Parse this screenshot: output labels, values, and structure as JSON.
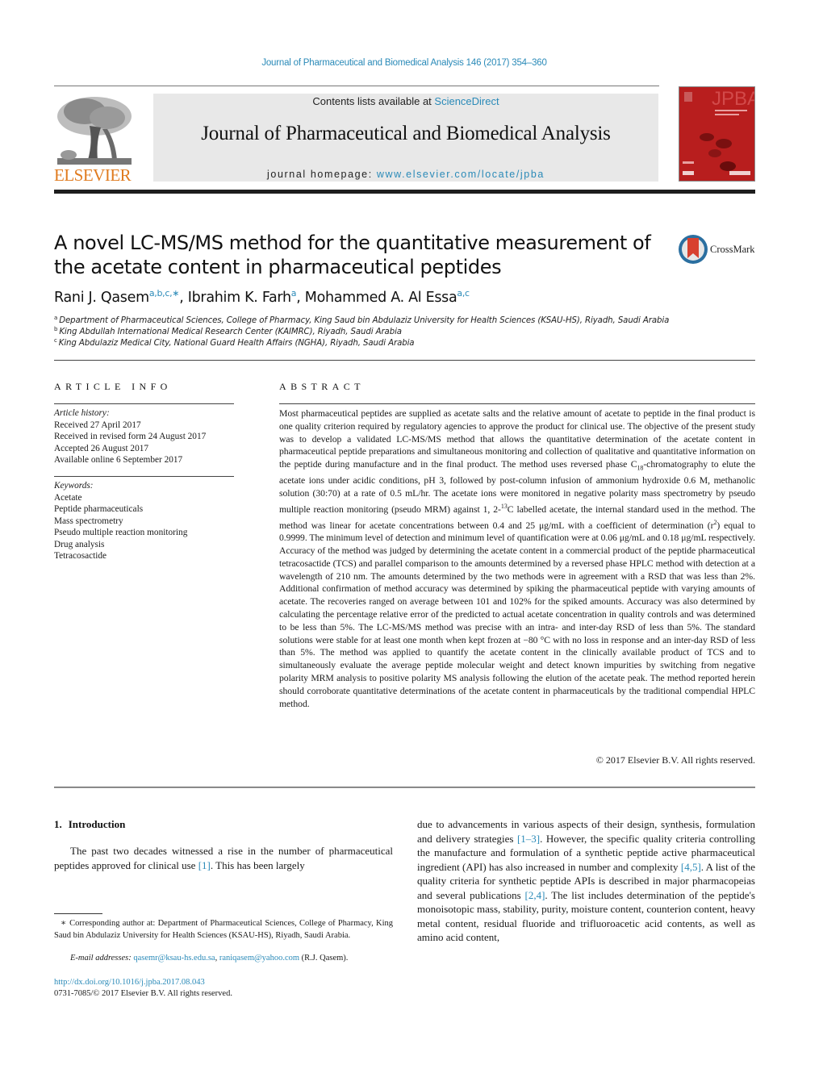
{
  "header": {
    "citation": "Journal of Pharmaceutical and Biomedical Analysis 146 (2017) 354–360",
    "contents_prefix": "Contents lists available at ",
    "contents_link": "ScienceDirect",
    "journal_title": "Journal of Pharmaceutical and Biomedical Analysis",
    "homepage_prefix": "journal homepage: ",
    "homepage_link": "www.elsevier.com/locate/jpba",
    "publisher_logo_text": "ELSEVIER",
    "cover_text": "JPBA",
    "colors": {
      "link": "#2a8ab8",
      "elsevier_orange": "#e07b1f",
      "cover_red": "#b81e1e",
      "banner_grey": "#e8e8e8"
    }
  },
  "article": {
    "title": "A novel LC-MS/MS method for the quantitative measurement of the acetate content in pharmaceutical peptides",
    "crossmark_label": "CrossMark",
    "authors": [
      {
        "name": "Rani J. Qasem",
        "affil": "a,b,c,∗",
        "sep": ", "
      },
      {
        "name": "Ibrahim K. Farh",
        "affil": "a",
        "sep": ", "
      },
      {
        "name": "Mohammed A. Al Essa",
        "affil": "a,c",
        "sep": ""
      }
    ],
    "affiliations": [
      {
        "key": "a",
        "text": "Department of Pharmaceutical Sciences, College of Pharmacy, King Saud bin Abdulaziz University for Health Sciences (KSAU-HS), Riyadh, Saudi Arabia"
      },
      {
        "key": "b",
        "text": "King Abdullah International Medical Research Center (KAIMRC), Riyadh, Saudi Arabia"
      },
      {
        "key": "c",
        "text": "King Abdulaziz Medical City, National Guard Health Affairs (NGHA), Riyadh, Saudi Arabia"
      }
    ]
  },
  "article_info": {
    "heading": "ARTICLE INFO",
    "history_label": "Article history:",
    "history": [
      "Received 27 April 2017",
      "Received in revised form 24 August 2017",
      "Accepted 26 August 2017",
      "Available online 6 September 2017"
    ],
    "keywords_label": "Keywords:",
    "keywords": [
      "Acetate",
      "Peptide pharmaceuticals",
      "Mass spectrometry",
      "Pseudo multiple reaction monitoring",
      "Drug analysis",
      "Tetracosactide"
    ]
  },
  "abstract": {
    "heading": "ABSTRACT",
    "p1": "Most pharmaceutical peptides are supplied as acetate salts and the relative amount of acetate to peptide in the final product is one quality criterion required by regulatory agencies to approve the product for clinical use. The objective of the present study was to develop a validated LC-MS/MS method that allows the quantitative determination of the acetate content in pharmaceutical peptide preparations and simultaneous monitoring and collection of qualitative and quantitative information on the peptide during manufacture and in the final product. The method uses reversed phase C",
    "sub18": "18",
    "p2": "-chromatography to elute the acetate ions under acidic conditions, pH 3, followed by post-column infusion of ammonium hydroxide 0.6 M, methanolic solution (30:70) at a rate of 0.5 mL/hr. The acetate ions were monitored in negative polarity mass spectrometry by pseudo multiple reaction monitoring (pseudo MRM) against 1, 2-",
    "sup13": "13",
    "p3": "C labelled acetate, the internal standard used in the method. The method was linear for acetate concentrations between 0.4 and 25 μg/mL with a coefficient of determination (r",
    "sup2": "2",
    "p4": ") equal to 0.9999. The minimum level of detection and minimum level of quantification were at 0.06 μg/mL and 0.18 μg/mL respectively. Accuracy of the method was judged by determining the acetate content in a commercial product of the peptide pharmaceutical tetracosactide (TCS) and parallel comparison to the amounts determined by a reversed phase HPLC method with detection at a wavelength of 210 nm. The amounts determined by the two methods were in agreement with a RSD that was less than 2%. Additional confirmation of method accuracy was determined by spiking the pharmaceutical peptide with varying amounts of acetate. The recoveries ranged on average between 101 and 102% for the spiked amounts. Accuracy was also determined by calculating the percentage relative error of the predicted to actual acetate concentration in quality controls and was determined to be less than 5%. The LC-MS/MS method was precise with an intra- and inter-day RSD of less than 5%. The standard solutions were stable for at least one month when kept frozen at −80 °C with no loss in response and an inter-day RSD of less than 5%. The method was applied to quantify the acetate content in the clinically available product of TCS and to simultaneously evaluate the average peptide molecular weight and detect known impurities by switching from negative polarity MRM analysis to positive polarity MS analysis following the elution of the acetate peak. The method reported herein should corroborate quantitative determinations of the acetate content in pharmaceuticals by the traditional compendial HPLC method.",
    "copyright": "© 2017 Elsevier B.V. All rights reserved."
  },
  "introduction": {
    "number": "1.",
    "heading": "Introduction",
    "left_a": "The past two decades witnessed a rise in the number of pharmaceutical peptides approved for clinical use ",
    "ref1": "[1]",
    "left_b": ". This has been largely",
    "right_a": "due to advancements in various aspects of their design, synthesis, formulation and delivery strategies ",
    "ref2": "[1–3]",
    "right_b": ". However, the specific quality criteria controlling the manufacture and formulation of a synthetic peptide active pharmaceutical ingredient (API) has also increased in number and complexity ",
    "ref3": "[4,5]",
    "right_c": ". A list of the quality criteria for synthetic peptide APIs is described in major pharmacopeias and several publications ",
    "ref4": "[2,4]",
    "right_d": ". The list includes determination of the peptide's monoisotopic mass, stability, purity, moisture content, counterion content, heavy metal content, residual fluoride and trifluoroacetic acid contents, as well as amino acid content,"
  },
  "footnotes": {
    "star": "∗",
    "corresponding": "Corresponding author at: Department of Pharmaceutical Sciences, College of Pharmacy, King Saud bin Abdulaziz University for Health Sciences (KSAU-HS), Riyadh, Saudi Arabia.",
    "email_label": "E-mail addresses:",
    "email1": "qasemr@ksau-hs.edu.sa",
    "email_sep": ", ",
    "email2": "raniqasem@yahoo.com",
    "email_owner": " (R.J. Qasem).",
    "doi": "http://dx.doi.org/10.1016/j.jpba.2017.08.043",
    "issn": "0731-7085/© 2017 Elsevier B.V. All rights reserved."
  }
}
